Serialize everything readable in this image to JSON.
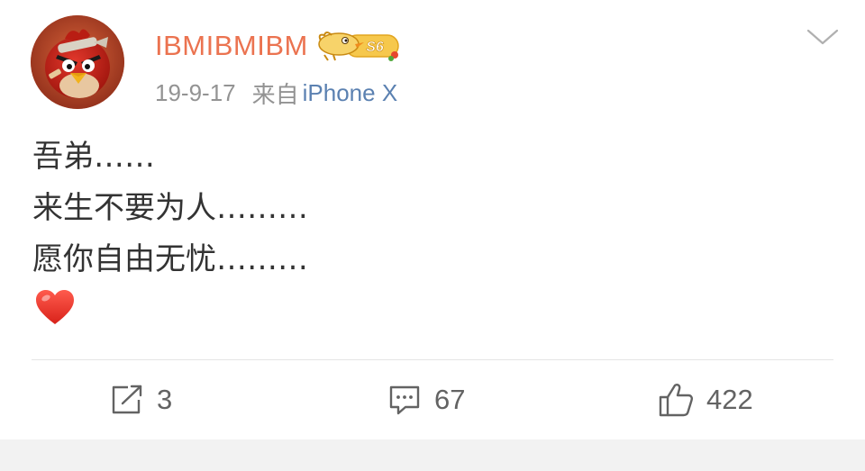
{
  "post": {
    "author": {
      "name": "IBMIBMIBM",
      "badge_text": "S6",
      "name_color": "#eb7350"
    },
    "meta": {
      "time": "19-9-17",
      "from_label": "来自",
      "source": "iPhone X"
    },
    "content_lines": [
      "吾弟……",
      "来生不要为人………",
      "愿你自由无忧………"
    ],
    "content_emoji": "heart-emoji"
  },
  "actions": {
    "repost": {
      "icon": "share-icon",
      "count": "3"
    },
    "comment": {
      "icon": "comment-icon",
      "count": "67"
    },
    "like": {
      "icon": "thumbs-up-icon",
      "count": "422"
    }
  },
  "colors": {
    "accent": "#eb7350",
    "link": "#5b81b1",
    "meta": "#939393",
    "text": "#333333",
    "icon": "#636363",
    "divider": "#e4e4e4",
    "heart": "#e8352d"
  }
}
